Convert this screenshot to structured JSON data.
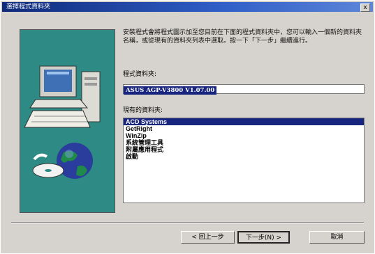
{
  "window": {
    "title": "選擇程式資料夾",
    "close_label": "x"
  },
  "wizard": {
    "description": "安裝程式會將程式圖示加至您目前在下面的程式資料夾中，您可以輸入一個新的資料夾名稱，或從現有的資料夾列表中選取。按一下「下一步」繼續進行。",
    "folder_label": "程式資料夾:",
    "folder_value": "ASUS AGP-V3800 V1.07.00",
    "existing_label": "現有的資料夾:",
    "folders": [
      "ACD Systems",
      "GetRight",
      "WinZip",
      "系統管理工具",
      "附屬應用程式",
      "啟動"
    ],
    "selected_index": 0
  },
  "buttons": {
    "back": "< 回上一步",
    "next": "下一步(N) >",
    "cancel": "取消"
  }
}
